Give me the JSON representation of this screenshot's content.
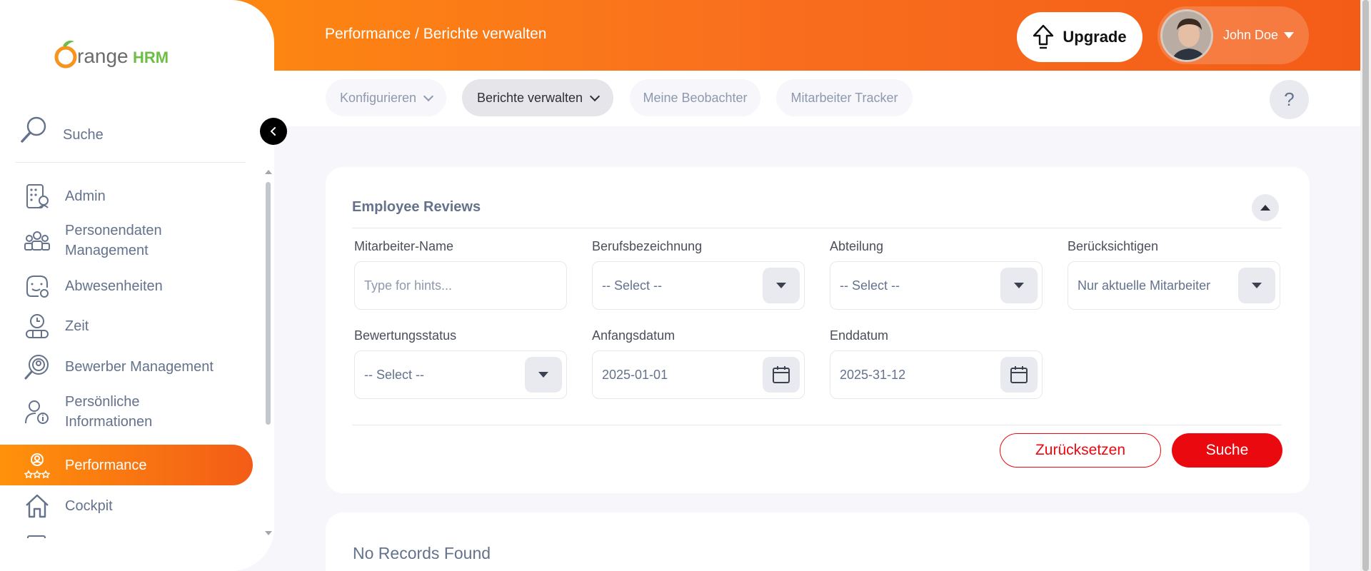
{
  "app": {
    "logo_text": "OrangeHRM",
    "brand_color": "#f96f1e",
    "accent_red": "#eb0910"
  },
  "header": {
    "breadcrumb": "Performance / Berichte verwalten",
    "upgrade_label": "Upgrade",
    "user_name": "John Doe"
  },
  "topnav": {
    "tabs": [
      {
        "label": "Konfigurieren",
        "has_dropdown": true,
        "active": false
      },
      {
        "label": "Berichte verwalten",
        "has_dropdown": true,
        "active": true
      },
      {
        "label": "Meine Beobachter",
        "has_dropdown": false,
        "active": false
      },
      {
        "label": "Mitarbeiter Tracker",
        "has_dropdown": false,
        "active": false
      }
    ],
    "help_label": "?"
  },
  "sidebar": {
    "search_label": "Suche",
    "items": [
      {
        "label": "Admin",
        "icon": "admin-icon"
      },
      {
        "label": "Personendaten Management",
        "icon": "people-icon"
      },
      {
        "label": "Abwesenheiten",
        "icon": "leave-icon"
      },
      {
        "label": "Zeit",
        "icon": "clock-icon"
      },
      {
        "label": "Bewerber Management",
        "icon": "recruitment-icon"
      },
      {
        "label": "Persönliche Informationen",
        "icon": "person-info-icon"
      },
      {
        "label": "Performance",
        "icon": "performance-icon",
        "active": true
      },
      {
        "label": "Cockpit",
        "icon": "home-icon"
      }
    ]
  },
  "filter": {
    "title": "Employee Reviews",
    "fields": {
      "employee_name": {
        "label": "Mitarbeiter-Name",
        "placeholder": "Type for hints..."
      },
      "job_title": {
        "label": "Berufsbezeichnung",
        "value": "-- Select --"
      },
      "department": {
        "label": "Abteilung",
        "value": "-- Select --"
      },
      "include": {
        "label": "Berücksichtigen",
        "value": "Nur aktuelle Mitarbeiter"
      },
      "review_status": {
        "label": "Bewertungsstatus",
        "value": "-- Select --"
      },
      "from_date": {
        "label": "Anfangsdatum",
        "value": "2025-01-01"
      },
      "to_date": {
        "label": "Enddatum",
        "value": "2025-31-12"
      }
    },
    "reset_label": "Zurücksetzen",
    "search_label": "Suche"
  },
  "results": {
    "message": "No Records Found"
  }
}
